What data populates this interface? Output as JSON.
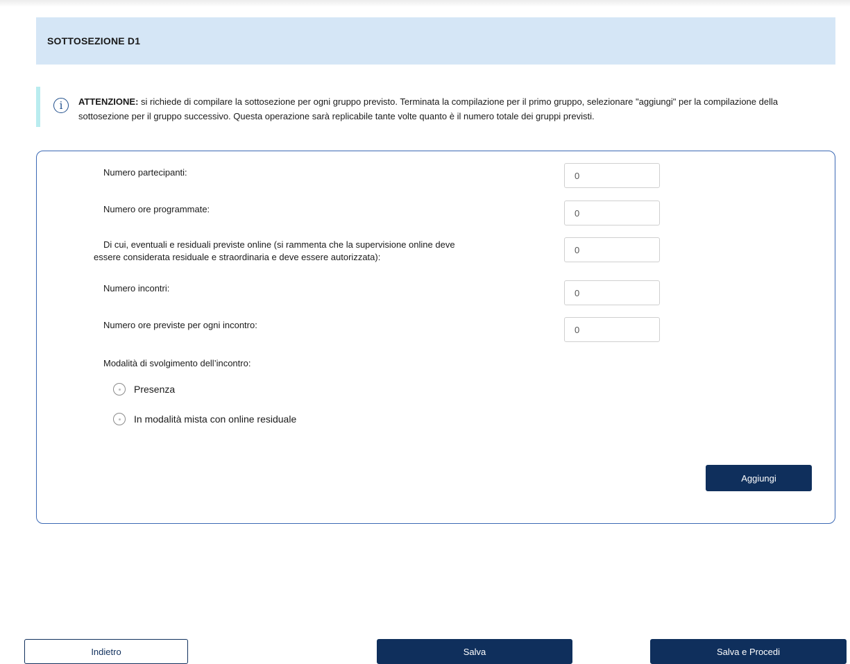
{
  "section": {
    "title": "SOTTOSEZIONE D1"
  },
  "notice": {
    "icon": "info-icon",
    "bold": "ATTENZIONE:",
    "text": " si richiede di compilare la sottosezione per ogni gruppo previsto. Terminata la compilazione per il primo gruppo, selezionare \"aggiungi\" per la compilazione della sottosezione per il gruppo successivo. Questa operazione sarà replicabile tante volte quanto è il numero totale dei gruppi previsti."
  },
  "form": {
    "fields": [
      {
        "label": "Numero partecipanti:",
        "value": "0"
      },
      {
        "label": "Numero ore programmate:",
        "value": "0"
      },
      {
        "label_line1": "Di cui, eventuali e residuali previste online (si rammenta che la supervisione online deve",
        "label_line2": "essere considerata residuale e straordinaria e deve essere autorizzata):",
        "value": "0"
      },
      {
        "label": "Numero incontri:",
        "value": "0"
      },
      {
        "label": "Numero ore previste per ogni incontro:",
        "value": "0"
      }
    ],
    "mode_label": "Modalità di svolgimento dell’incontro:",
    "mode_options": [
      "Presenza",
      "In modalità mista con online residuale"
    ],
    "add_button": "Aggiungi"
  },
  "footer": {
    "back": "Indietro",
    "save": "Salva",
    "save_next": "Salva e Procedi"
  },
  "colors": {
    "header_bg": "#d5e6f6",
    "primary": "#0f2f5c",
    "border": "#3a68b4",
    "notice_bar": "#b9ecef"
  }
}
